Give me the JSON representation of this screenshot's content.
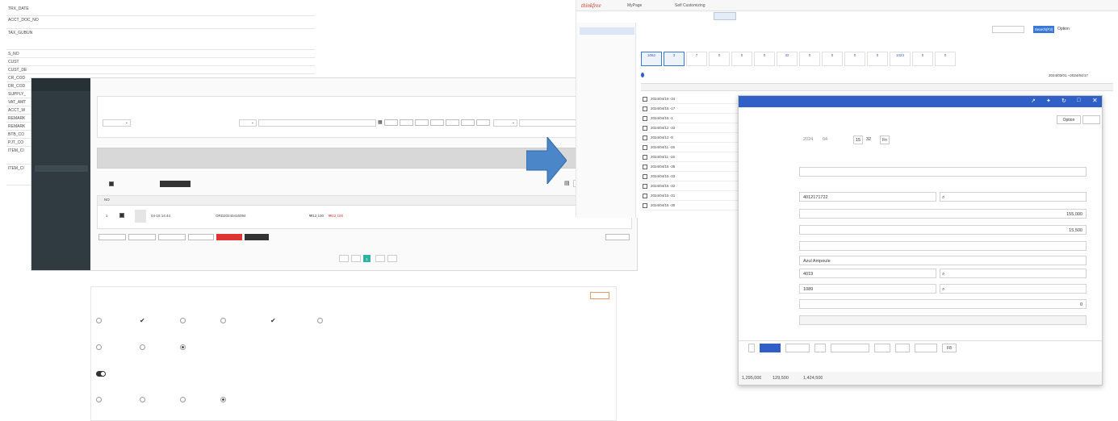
{
  "colors": {
    "order_sidebar_bg": "#2f3b41",
    "erp_accent_blue": "#2f5fc7",
    "erp_logo_red": "#c0392b",
    "pager_active": "#2bb3a3",
    "arrow_blue": "#4a86c8"
  },
  "spec_doc": {
    "rows": [
      {
        "name": "TRX_DATE",
        "type": "",
        "flag": "",
        "desc": ""
      },
      {
        "name": "ACCT_DOC_NO",
        "type": "",
        "flag": "",
        "desc": ""
      },
      {
        "name": "TAX_GUBUN",
        "type": "",
        "flag": "",
        "desc": ""
      },
      {
        "name": "S_NO",
        "type": "",
        "flag": "",
        "desc": ""
      },
      {
        "name": "CUST",
        "type": "",
        "flag": "",
        "desc": ""
      },
      {
        "name": "CUST_DE",
        "type": "",
        "flag": "",
        "desc": ""
      },
      {
        "name": "CR_COD",
        "type": "",
        "flag": "",
        "desc": ""
      },
      {
        "name": "DR_COD",
        "type": "",
        "flag": "",
        "desc": ""
      },
      {
        "name": "SUPPLY_",
        "type": "",
        "flag": "",
        "desc": ""
      },
      {
        "name": "VAT_AMT",
        "type": "",
        "flag": "",
        "desc": ""
      },
      {
        "name": "ACCT_W",
        "type": "",
        "flag": "",
        "desc": ""
      },
      {
        "name": "REMARK",
        "type": "",
        "flag": "",
        "desc": ""
      },
      {
        "name": "REMARK",
        "type": "",
        "flag": "",
        "desc": ""
      },
      {
        "name": "BTB_CO",
        "type": "",
        "flag": "",
        "desc": ""
      },
      {
        "name": "PJT_CO",
        "type": "",
        "flag": "",
        "desc": ""
      },
      {
        "name": "ITEM_CI",
        "type": "",
        "flag": "",
        "desc": ""
      },
      {
        "name": "ITEM_CI",
        "type": "",
        "flag": "",
        "desc": ""
      }
    ]
  },
  "order_panel": {
    "sidebar_title": "",
    "sidebar_items": [
      "",
      "",
      "",
      "",
      "",
      "",
      "",
      "",
      "",
      "",
      "",
      "",
      "",
      ""
    ],
    "active_sidebar_index": 8,
    "page_title": "",
    "section_title": "",
    "filter": {
      "select_1": "",
      "select_2": "",
      "date_buttons": [
        "",
        "",
        "",
        "",
        "",
        "",
        ""
      ],
      "select_3": "",
      "placeholder": ""
    },
    "summary_text": "",
    "table": {
      "toolbar_text": "",
      "toolbar_button": "",
      "sort_select": "",
      "headers": [
        "NO",
        "",
        "",
        "",
        "",
        "",
        "",
        "",
        "",
        "",
        "",
        "",
        "",
        ""
      ],
      "rows": [
        {
          "no": "1",
          "date": "04-15 14:44",
          "buyer": "",
          "order_no": "ORD20240415094",
          "product": "",
          "price": "₩12,100",
          "pay": "₩12,100",
          "qty": "",
          "status": "",
          "zip": "",
          "addr": ""
        }
      ]
    },
    "action_buttons": [
      "",
      "",
      "",
      "",
      "",
      ""
    ],
    "right_button": "",
    "pager": {
      "prev_first": "",
      "prev": "",
      "current": "1",
      "next": "",
      "last": ""
    }
  },
  "erp": {
    "logo": "thinkfree",
    "nav": [
      "MyPage",
      "Self Customizing",
      "",
      "",
      "",
      "",
      "",
      "",
      "",
      ""
    ],
    "subtabs": [
      "",
      "",
      "",
      "",
      "",
      "",
      "",
      "",
      "",
      "",
      "",
      ""
    ],
    "active_subtab_index": 3,
    "search_placeholder": "",
    "search_button": "Search(F3)",
    "option_button": "Option",
    "help_button": "",
    "sidebar_title": "",
    "sidebar_items": [
      "",
      "",
      "",
      "",
      "",
      "",
      "",
      "",
      "",
      ""
    ],
    "active_sidebar_index": 0,
    "date_range": "2024/03/01 ~2024/04/17",
    "list_rows": [
      {
        "date": "2024/04/16 -34"
      },
      {
        "date": "2024/04/15 -17"
      },
      {
        "date": "2024/04/15 -1"
      },
      {
        "date": "2024/04/12 -33"
      },
      {
        "date": "2024/04/12 -8"
      },
      {
        "date": "2024/04/11 -15"
      },
      {
        "date": "2024/04/11 -16"
      },
      {
        "date": "2024/04/15 -35"
      },
      {
        "date": "2024/04/15 -33"
      },
      {
        "date": "2024/04/15 -32"
      },
      {
        "date": "2024/04/15 -31"
      },
      {
        "date": "2024/04/15 -30"
      }
    ],
    "status_counts": [
      {
        "label": "",
        "value": "1062"
      },
      {
        "label": "",
        "value": "3"
      },
      {
        "label": "",
        "value": "7"
      },
      {
        "label": "",
        "value": "0"
      },
      {
        "label": "",
        "value": "0"
      },
      {
        "label": "",
        "value": "0"
      },
      {
        "label": "",
        "value": "32"
      },
      {
        "label": "",
        "value": "0"
      },
      {
        "label": "",
        "value": "0"
      },
      {
        "label": "",
        "value": "0"
      },
      {
        "label": "",
        "value": "0"
      },
      {
        "label": "",
        "value": "1023"
      },
      {
        "label": "",
        "value": "0"
      },
      {
        "label": "",
        "value": "0"
      }
    ],
    "bottom_values": [
      "1,295,000",
      "129,500",
      "1,424,500",
      ""
    ]
  },
  "slip": {
    "window_title": "",
    "heading": "",
    "option_button": "Option",
    "help_button": "",
    "date": {
      "year": "2024",
      "month": "04",
      "day": "15",
      "seq": "32",
      "fn": "Fn"
    },
    "fields": [
      {
        "label": "",
        "value": "2024"
      },
      {
        "label": "",
        "value": ""
      },
      {
        "label": "",
        "value": ""
      },
      {
        "label": "",
        "value": "4012171722"
      },
      {
        "label": "",
        "value": "155,000"
      },
      {
        "label": "",
        "value": "15,500"
      },
      {
        "label": "",
        "value": ""
      },
      {
        "label": "",
        "value": "Azul Ampoule"
      },
      {
        "label": "",
        "value": "4019"
      },
      {
        "label": "",
        "value": "1089"
      },
      {
        "label": "",
        "value": "0"
      },
      {
        "label": "",
        "value": ""
      }
    ],
    "footer_buttons": [
      "",
      "",
      "",
      "",
      "",
      "",
      "",
      "",
      "F8"
    ]
  },
  "settings": {
    "title": "",
    "apply_button": "",
    "sections": [
      {
        "title": "",
        "options": [
          "",
          "",
          "",
          "",
          "",
          ""
        ],
        "selected": [
          1,
          4
        ]
      },
      {
        "title": "",
        "options": [
          "",
          "",
          ""
        ],
        "selected": [
          2
        ]
      },
      {
        "title": "",
        "toggle_label": ""
      },
      {
        "title": "",
        "options": [
          "",
          "",
          "",
          ""
        ],
        "selected": [
          3
        ]
      },
      {
        "title": ""
      }
    ]
  }
}
